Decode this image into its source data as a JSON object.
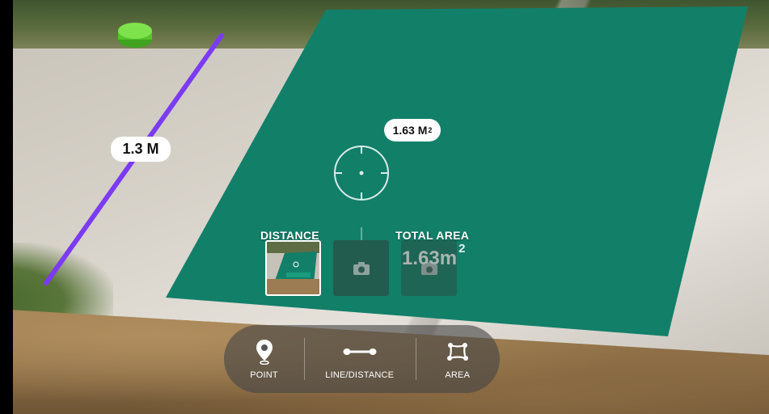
{
  "measurements": {
    "line_label": "1.3 M",
    "area_label_value": "1.63 M",
    "area_label_unit_sup": "2"
  },
  "panel": {
    "distance_title": "DISTANCE",
    "total_area_title": "TOTAL AREA",
    "total_area_value": "1.63m",
    "total_area_sup": "2"
  },
  "toolbar": {
    "items": [
      {
        "label": "POINT",
        "icon": "location-pin-icon"
      },
      {
        "label": "LINE/DISTANCE",
        "icon": "line-distance-icon"
      },
      {
        "label": "AREA",
        "icon": "area-polygon-icon"
      }
    ]
  },
  "colors": {
    "area_fill": "#127f69",
    "line_color": "#7b3bf2",
    "anchor_color": "#62d33a",
    "toolbar_bg": "#464646"
  }
}
